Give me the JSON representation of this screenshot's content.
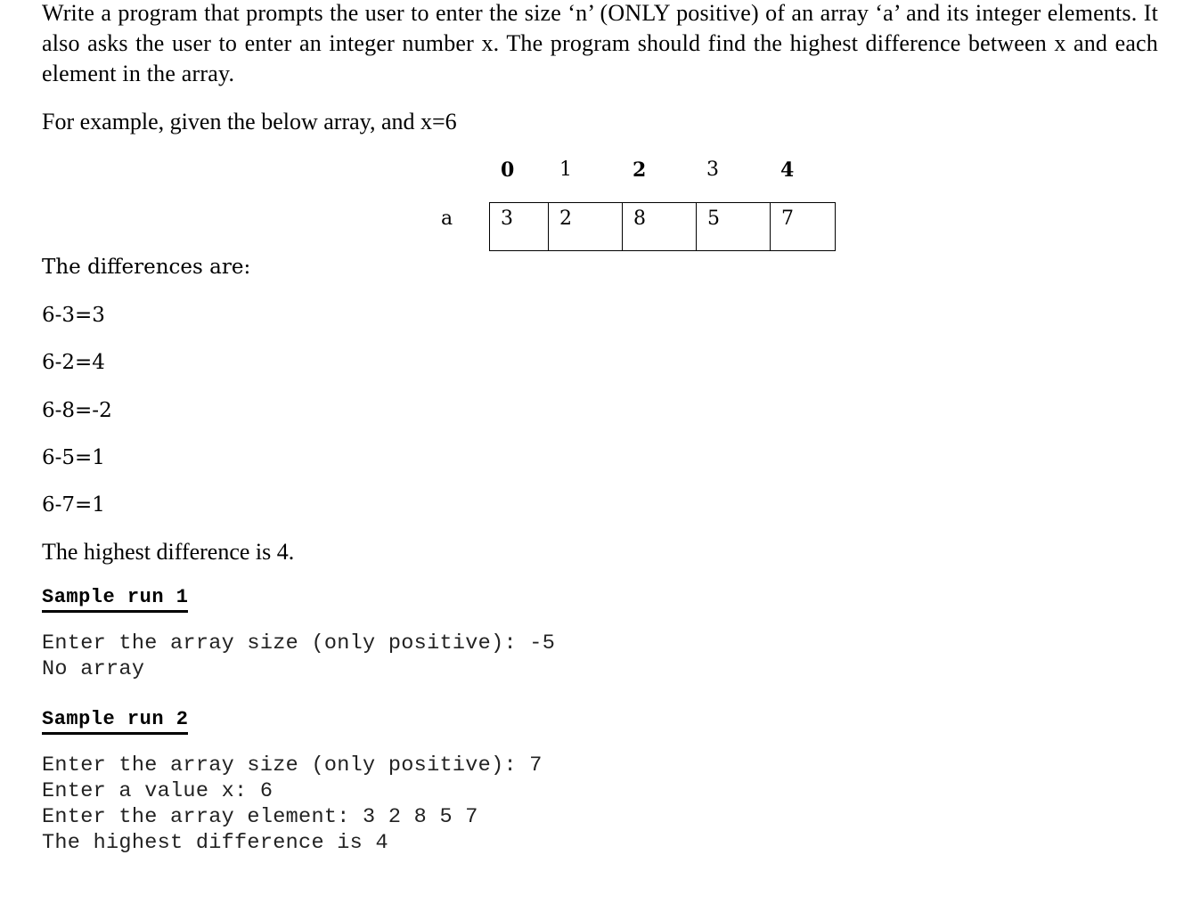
{
  "problem": {
    "intro": "Write a program that prompts the user to enter the size ‘n’ (ONLY positive) of an array ‘a’ and its integer elements. It also asks the user to enter an integer number x. The program should find the highest difference between x and each element in the array.",
    "example_intro": "For example, given the below array, and x=6"
  },
  "array_diagram": {
    "name": "a",
    "indices": [
      "0",
      "1",
      "2",
      "3",
      "4"
    ],
    "bold_indices": [
      0,
      2,
      4
    ],
    "values": [
      "3",
      "2",
      "8",
      "5",
      "7"
    ]
  },
  "differences": {
    "heading": "The differences are:",
    "lines": [
      "6-3=3",
      "6-2=4",
      "6-8=-2",
      "6-5=1",
      "6-7=1"
    ],
    "conclusion": "The highest difference is 4."
  },
  "sample_runs": [
    {
      "heading": "Sample run 1",
      "lines": [
        "Enter the array size (only positive): -5",
        "No array"
      ]
    },
    {
      "heading": "Sample run 2",
      "lines": [
        "Enter the array size (only positive): 7",
        "Enter a value x: 6",
        "Enter the array element: 3 2 8 5 7",
        "The highest difference is 4"
      ]
    }
  ]
}
